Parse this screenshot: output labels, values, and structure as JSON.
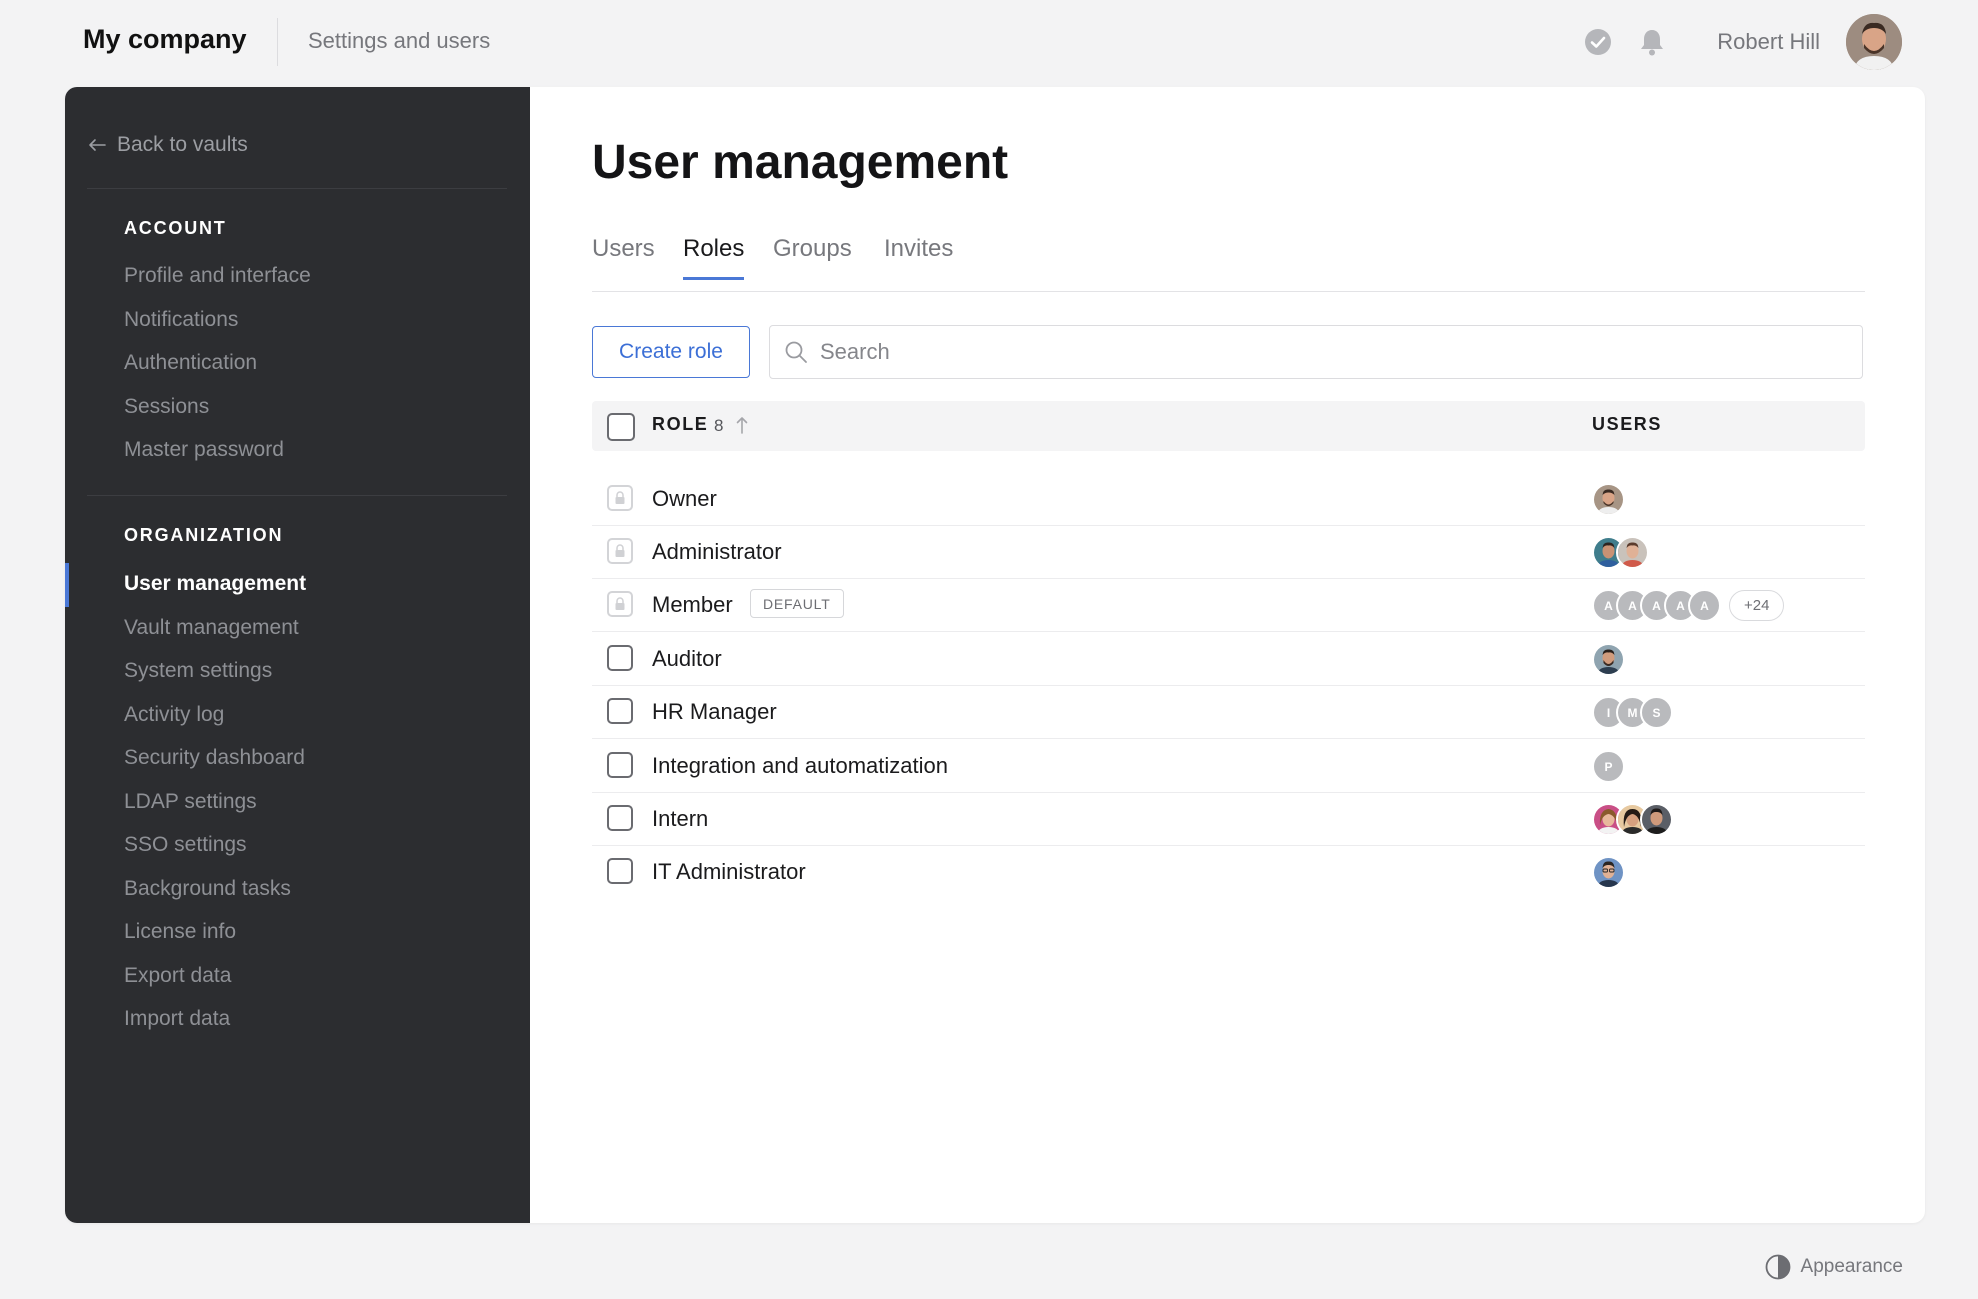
{
  "header": {
    "brand": "My company",
    "breadcrumb": "Settings and users",
    "user_name": "Robert Hill"
  },
  "sidebar": {
    "back_label": "Back to vaults",
    "account_title": "ACCOUNT",
    "account_items": [
      "Profile and interface",
      "Notifications",
      "Authentication",
      "Sessions",
      "Master password"
    ],
    "org_title": "ORGANIZATION",
    "org_items": [
      "User management",
      "Vault management",
      "System settings",
      "Activity log",
      "Security dashboard",
      "LDAP settings",
      "SSO settings",
      "Background tasks",
      "License info",
      "Export data",
      "Import data"
    ],
    "active_item": "User management"
  },
  "main": {
    "title": "User management",
    "tabs": [
      "Users",
      "Roles",
      "Groups",
      "Invites"
    ],
    "active_tab": "Roles",
    "create_button": "Create role",
    "search_placeholder": "Search",
    "table": {
      "col_role": "ROLE",
      "role_count": "8",
      "col_users": "USERS",
      "rows": [
        {
          "name": "Owner",
          "locked": true,
          "badge": "",
          "users": [
            "photo"
          ],
          "more": ""
        },
        {
          "name": "Administrator",
          "locked": true,
          "badge": "",
          "users": [
            "photo",
            "photo"
          ],
          "more": ""
        },
        {
          "name": "Member",
          "locked": true,
          "badge": "DEFAULT",
          "users": [
            "A",
            "A",
            "A",
            "A",
            "A"
          ],
          "more": "+24"
        },
        {
          "name": "Auditor",
          "locked": false,
          "badge": "",
          "users": [
            "photo"
          ],
          "more": ""
        },
        {
          "name": "HR Manager",
          "locked": false,
          "badge": "",
          "users": [
            "I",
            "M",
            "S"
          ],
          "more": ""
        },
        {
          "name": "Integration and automatization",
          "locked": false,
          "badge": "",
          "users": [
            "P"
          ],
          "more": ""
        },
        {
          "name": "Intern",
          "locked": false,
          "badge": "",
          "users": [
            "photo",
            "photo",
            "photo"
          ],
          "more": ""
        },
        {
          "name": "IT Administrator",
          "locked": false,
          "badge": "",
          "users": [
            "photo"
          ],
          "more": ""
        }
      ]
    }
  },
  "footer": {
    "appearance_label": "Appearance"
  },
  "colors": {
    "accent": "#4a78d6",
    "sidebar_bg": "#2c2d30",
    "page_bg": "#f3f3f4"
  }
}
